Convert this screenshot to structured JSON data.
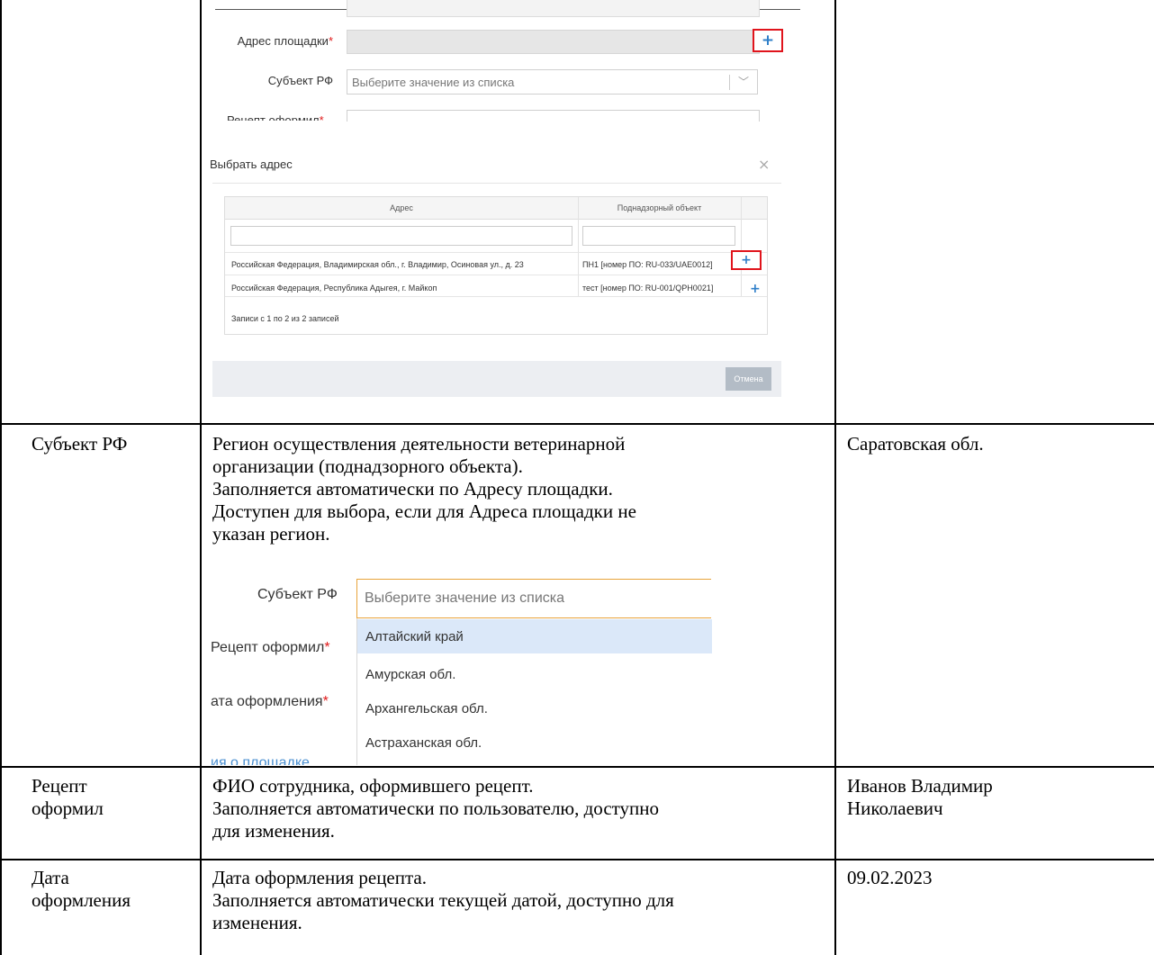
{
  "screenshot1": {
    "address_label": "Адрес площадки",
    "required_mark": "*",
    "subject_label": "Субъект РФ",
    "subject_placeholder": "Выберите значение из списка",
    "cut_label": "Рецепт оформил",
    "modal": {
      "title": "Выбрать адрес",
      "close_icon": "×",
      "columns": [
        "Адрес",
        "Поднадзорный объект"
      ],
      "rows": [
        {
          "address": "Российская Федерация, Владимирская обл., г. Владимир, Осиновая ул., д. 23",
          "object": "ПН1 [номер ПО: RU-033/UAE0012]"
        },
        {
          "address": "Российская Федерация, Республика Адыгея, г. Майкоп",
          "object": "тест [номер ПО: RU-001/QPH0021]"
        }
      ],
      "records": "Записи с 1 по 2 из 2 записей",
      "cancel_label": "Отмена"
    }
  },
  "rows": [
    {
      "field": "Субъект РФ",
      "description": [
        "Регион осуществления деятельности ветеринарной",
        "организации (поднадзорного объекта).",
        "Заполняется автоматически по Адресу площадки.",
        "Доступен для выбора, если для Адреса площадки не",
        "указан регион."
      ],
      "example": "Саратовская обл."
    },
    {
      "field_lines": [
        "Рецепт",
        "оформил"
      ],
      "description": [
        "ФИО сотрудника, оформившего рецепт.",
        "Заполняется автоматически по пользователю, доступно",
        "для изменения."
      ],
      "example_lines": [
        "Иванов Владимир",
        "Николаевич"
      ]
    },
    {
      "field_lines": [
        "Дата",
        "оформления"
      ],
      "description": [
        "Дата оформления рецепта.",
        "Заполняется автоматически текущей датой, доступно для",
        "изменения."
      ],
      "example": "09.02.2023"
    }
  ],
  "screenshot2": {
    "subject_label": "Субъект РФ",
    "placeholder": "Выберите значение из списка",
    "recipe_label": "Рецепт оформил",
    "date_label": "ата оформления",
    "required_mark": "*",
    "options": [
      "Алтайский край",
      "Амурская обл.",
      "Архангельская обл.",
      "Астраханская обл."
    ],
    "cut_text": "ия о площадке"
  },
  "icons": {
    "plus": "+",
    "chevron": "﹀"
  },
  "colors": {
    "required": "#e01a1a",
    "plus": "#2f7fc9",
    "highlight_border": "#e0141c",
    "focus_border": "#e8a33b",
    "selected_option": "#dbe8f9"
  }
}
